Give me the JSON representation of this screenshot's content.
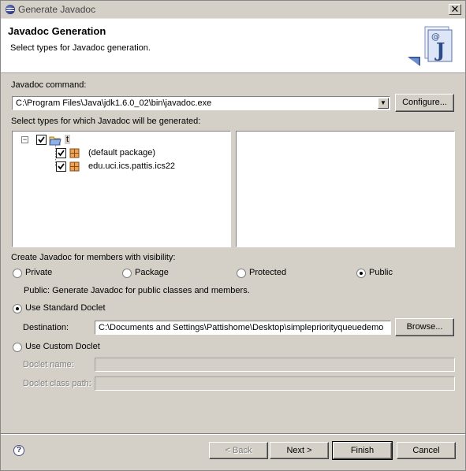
{
  "window": {
    "title": "Generate Javadoc",
    "close_glyph": "✕"
  },
  "header": {
    "title": "Javadoc Generation",
    "subtitle": "Select types for Javadoc generation.",
    "banner_icon": "javadoc-wizard-icon"
  },
  "javadoc_command": {
    "label": "Javadoc command:",
    "value": "C:\\Program Files\\Java\\jdk1.6.0_02\\bin\\javadoc.exe",
    "configure_label": "Configure..."
  },
  "types": {
    "label": "Select types for which Javadoc will be generated:",
    "tree": [
      {
        "label": "t",
        "checked": true,
        "icon": "project-folder-icon",
        "expanded": true
      },
      {
        "label": "(default package)",
        "checked": true,
        "icon": "package-icon"
      },
      {
        "label": "edu.uci.ics.pattis.ics22",
        "checked": true,
        "icon": "package-icon"
      }
    ]
  },
  "visibility": {
    "label": "Create Javadoc for members with visibility:",
    "options": [
      "Private",
      "Package",
      "Protected",
      "Public"
    ],
    "selected": "Public",
    "description": "Public: Generate Javadoc for public classes and members."
  },
  "doclet": {
    "standard_label": "Use Standard Doclet",
    "standard_selected": true,
    "destination_label": "Destination:",
    "destination_value": "C:\\Documents and Settings\\Pattishome\\Desktop\\simplepriorityqueuedemo",
    "browse_label": "Browse...",
    "custom_label": "Use Custom Doclet",
    "doclet_name_label": "Doclet name:",
    "doclet_name_value": "",
    "doclet_class_path_label": "Doclet class path:",
    "doclet_class_path_value": ""
  },
  "footer": {
    "help_glyph": "?",
    "back_label": "< Back",
    "next_label": "Next >",
    "finish_label": "Finish",
    "cancel_label": "Cancel"
  }
}
